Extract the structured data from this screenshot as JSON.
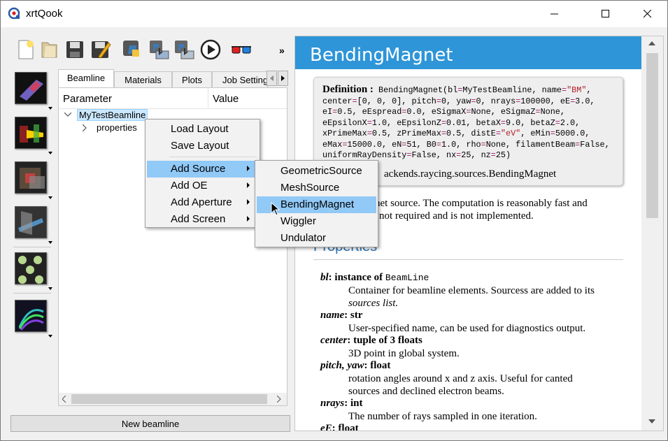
{
  "window": {
    "title": "xrtQook"
  },
  "tabs": [
    "Beamline",
    "Materials",
    "Plots",
    "Job Settings"
  ],
  "tree": {
    "columns": [
      "Parameter",
      "Value"
    ],
    "root": "MyTestBeamline",
    "child": "properties"
  },
  "new_beamline_label": "New beamline",
  "context_menu": {
    "items": [
      "Load Layout",
      "Save Layout",
      "Add Source",
      "Add OE",
      "Add Aperture",
      "Add Screen"
    ]
  },
  "source_submenu": {
    "items": [
      "GeometricSource",
      "MeshSource",
      "BendingMagnet",
      "Wiggler",
      "Undulator"
    ],
    "selected": "BendingMagnet"
  },
  "doc": {
    "title": "BendingMagnet",
    "definition_label": "Definition :",
    "definition_code": "BendingMagnet(bl=MyTestBeamline, name=\"BM\", center=[0, 0, 0], pitch=0, yaw=0, nrays=100000, eE=3.0, eI=0.5, eEspread=0.0, eSigmaX=None, eSigmaZ=None, eEpsilonX=1.0, eEpsilonZ=0.01, betaX=9.0, betaZ=2.0, xPrimeMax=0.5, zPrimeMax=0.5, distE=\"eV\", eMin=5000.0, eMax=15000.0, eN=51, B0=1.0, rho=None, filamentBeam=False, uniformRayDensity=False, nx=25, nz=25)",
    "class_path_visible": "ackends.raycing.sources.BendingMagnet",
    "intro_line1": "net source. The computation is reasonably fast and",
    "intro_line2": "not required and is not implemented.",
    "properties_title": "Properties",
    "props": [
      {
        "name": "bl",
        "type_prefix": "instance of ",
        "type_mono": "BeamLine",
        "desc": [
          "Container for beamline elements. Sourcess are added to its",
          "sources list."
        ]
      },
      {
        "name": "name",
        "type": "str",
        "desc": [
          "User-specified name, can be used for diagnostics output."
        ]
      },
      {
        "name": "center",
        "type": "tuple of 3 floats",
        "desc": [
          "3D point in global system."
        ]
      },
      {
        "name": "pitch, yaw",
        "type": "float",
        "desc": [
          "rotation angles around x and z axis. Useful for canted",
          "sources and declined electron beams."
        ]
      },
      {
        "name": "nrays",
        "type": "int",
        "desc": [
          "The number of rays sampled in one iteration."
        ]
      },
      {
        "name": "eE",
        "type": "float",
        "desc": []
      }
    ]
  },
  "toolbar_icons": [
    "new-file-icon",
    "open-folder-icon",
    "save-icon",
    "save-as-icon",
    "python-icon",
    "export-python-icon",
    "export-xml-icon",
    "run-icon",
    "glow-3d-glasses-icon"
  ],
  "sidebar_icons": [
    "sources-icon",
    "optics-icon",
    "apertures-icon",
    "screens-icon",
    "materials-icon",
    "plots-icon"
  ]
}
